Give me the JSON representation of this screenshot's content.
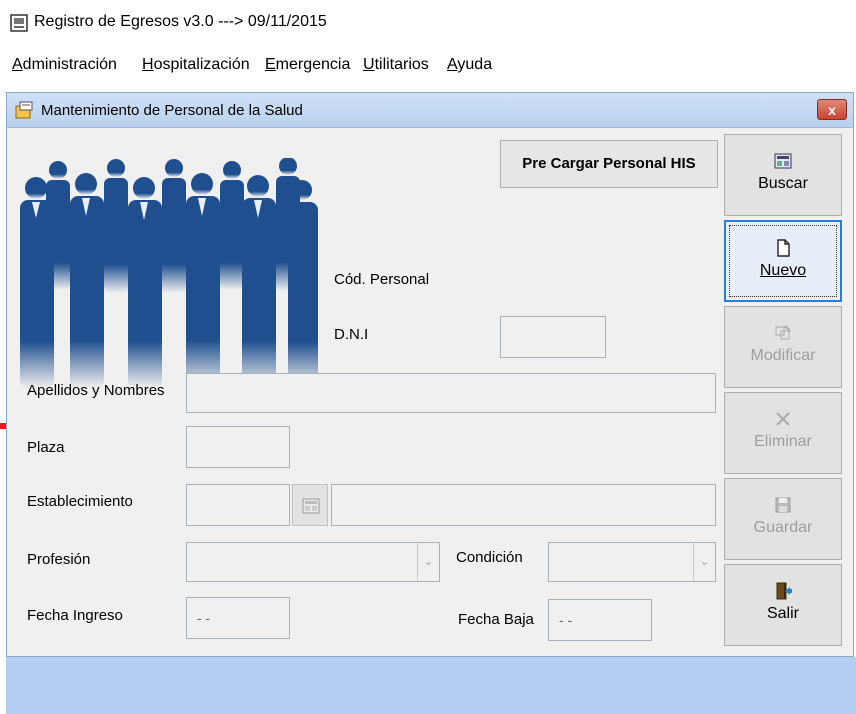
{
  "app": {
    "title": "Registro de Egresos v3.0  ---> 09/11/2015"
  },
  "menu": [
    {
      "first": "A",
      "rest": "dministración"
    },
    {
      "first": "H",
      "rest": "ospitalización"
    },
    {
      "first": "E",
      "rest": "mergencia"
    },
    {
      "first": "U",
      "rest": "tilitarios"
    },
    {
      "first": "A",
      "rest": "yuda"
    }
  ],
  "window": {
    "title": "Mantenimiento de Personal de la Salud",
    "close_label": "x"
  },
  "form": {
    "precargar_label": "Pre Cargar Personal HIS",
    "cod_personal_label": "Cód. Personal",
    "dni_label": "D.N.I",
    "dni_value": "",
    "apellidos_label": "Apellidos y Nombres",
    "apellidos_value": "",
    "plaza_label": "Plaza",
    "plaza_value": "",
    "establecimiento_label": "Establecimiento",
    "establecimiento_code": "",
    "establecimiento_name": "",
    "profesion_label": "Profesión",
    "profesion_value": "",
    "condicion_label": "Condición",
    "condicion_value": "",
    "fecha_ingreso_label": "Fecha Ingreso",
    "fecha_ingreso_value": "- -",
    "fecha_baja_label": "Fecha Baja",
    "fecha_baja_value": "- -"
  },
  "toolbar": {
    "buscar": "Buscar",
    "nuevo": "Nuevo",
    "modificar": "Modificar",
    "eliminar": "Eliminar",
    "guardar": "Guardar",
    "salir": "Salir"
  },
  "colors": {
    "accent": "#2a7fd4",
    "people_graphic": "#1f4f8f",
    "bottom_area": "#b3cef0"
  }
}
